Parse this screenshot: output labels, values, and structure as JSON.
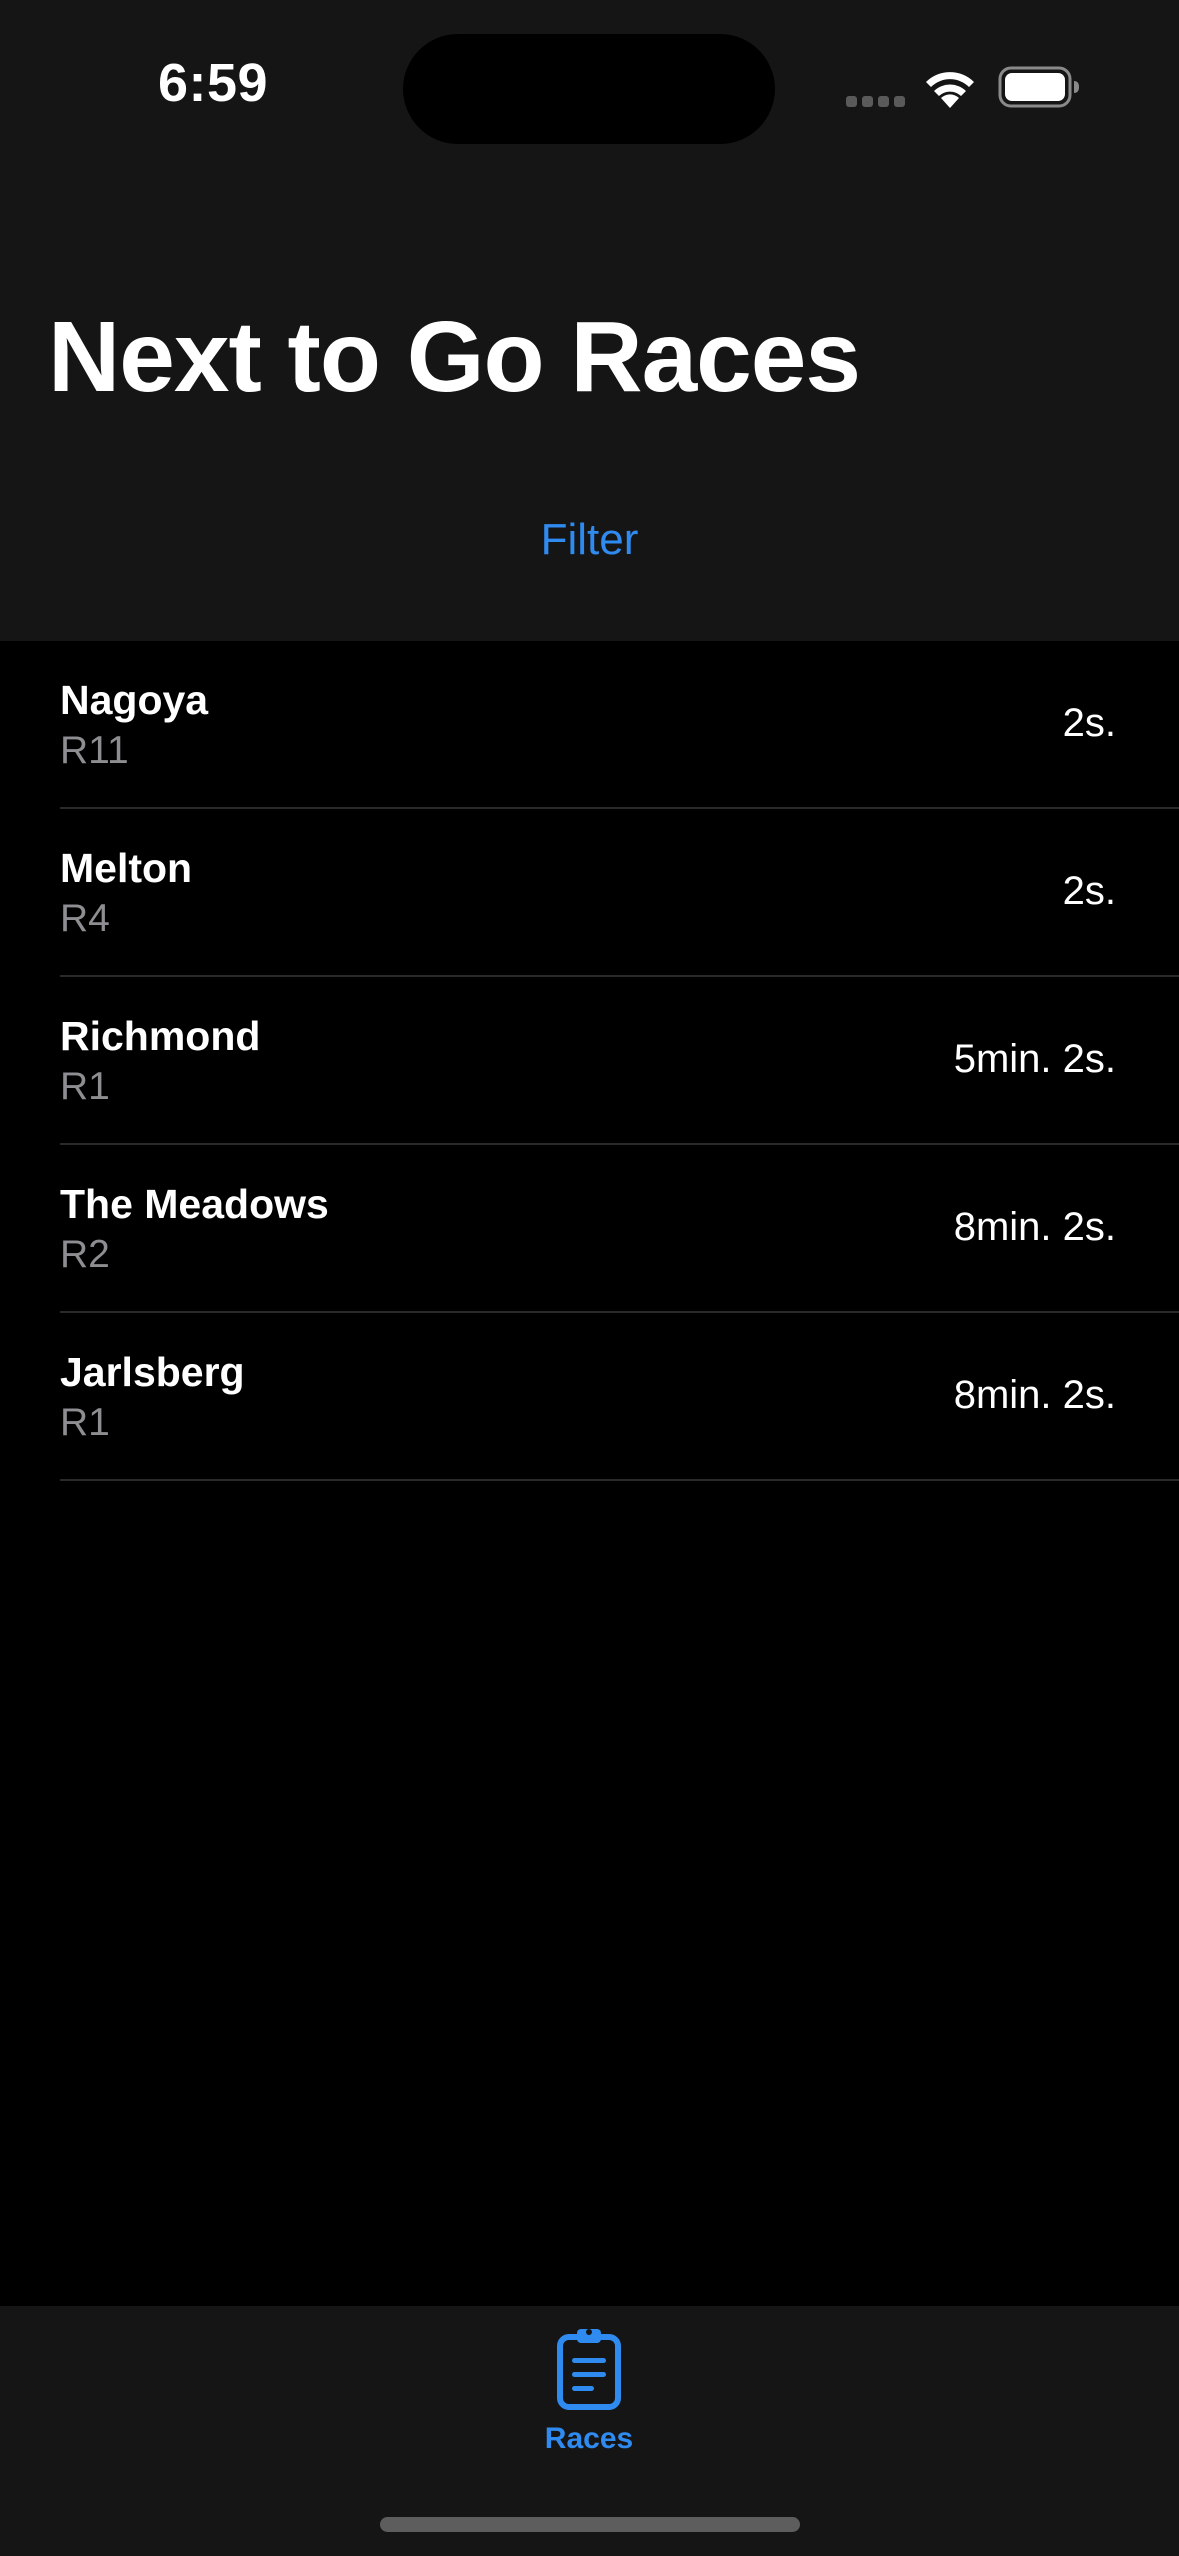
{
  "status_bar": {
    "time": "6:59"
  },
  "nav": {
    "title": "Next to Go Races",
    "filter_label": "Filter"
  },
  "races": [
    {
      "name": "Nagoya",
      "race_number": "R11",
      "countdown": "2s."
    },
    {
      "name": "Melton",
      "race_number": "R4",
      "countdown": "2s."
    },
    {
      "name": "Richmond",
      "race_number": "R1",
      "countdown": "5min. 2s."
    },
    {
      "name": "The Meadows",
      "race_number": "R2",
      "countdown": "8min. 2s."
    },
    {
      "name": "Jarlsberg",
      "race_number": "R1",
      "countdown": "8min. 2s."
    }
  ],
  "tab_bar": {
    "tabs": [
      {
        "label": "Races",
        "icon": "clipboard-icon",
        "selected": true
      }
    ]
  },
  "colors": {
    "accent": "#2f8bf0",
    "background": "#000000",
    "header_background": "#151515",
    "secondary_text": "#8d8d92"
  }
}
